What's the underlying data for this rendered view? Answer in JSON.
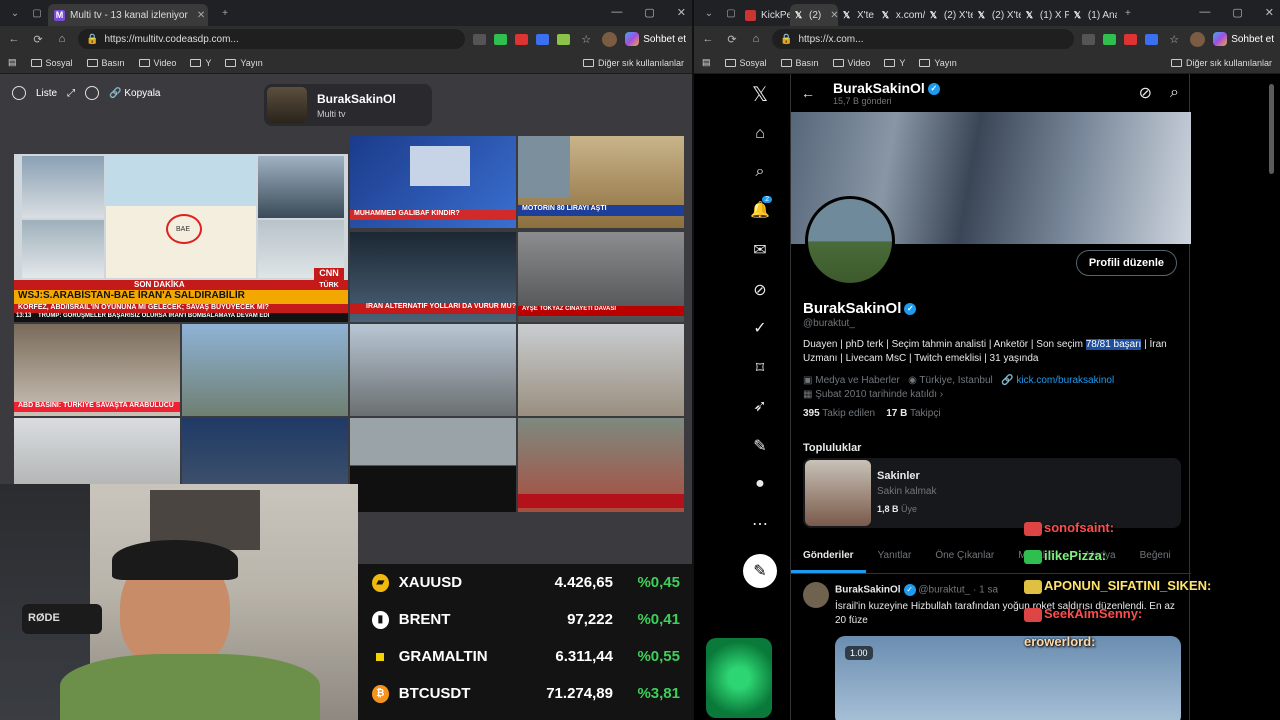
{
  "left_window": {
    "tab_title": "Multi tv - 13 kanal izleniyor",
    "url": "https://multitv.codeasdp.com...",
    "copilot_label": "Sohbet et",
    "bookmarks": [
      "Sosyal",
      "Basın",
      "Video",
      "Y",
      "Yayın"
    ],
    "bookmarks_right": "Diğer sık kullanılanlar"
  },
  "right_window": {
    "tabs": [
      "KickPe",
      "(2)",
      "X'te",
      "x.com/",
      "(2) X'te",
      "(2) X'te",
      "(1) X P",
      "(1) Ana"
    ],
    "url": "https://x.com...",
    "copilot_label": "Sohbet et",
    "bookmarks": [
      "Sosyal",
      "Basın",
      "Video",
      "Y",
      "Yayın"
    ],
    "bookmarks_right": "Diğer sık kullanılanlar"
  },
  "multitv": {
    "toolbar": {
      "list_label": "Liste",
      "copy_label": "Kopyala"
    },
    "channel": {
      "name": "BurakSakinOl",
      "subtitle": "Multi tv"
    },
    "tiles": {
      "cnn_son_dakika": "SON DAKİKA",
      "cnn_headline": "WSJ:S.ARABİSTAN-BAE İRAN'A SALDIRABİLİR",
      "cnn_sub": "KÖRFEZ, ABD/İSRAİL'İN OYUNUNA MI GELECEK; SAVAŞ BÜYÜYECEK Mİ?",
      "cnn_ticker": "TRUMP: GÖRÜŞMELER BAŞARISIZ OLURSA İRAN'I BOMBALAMAYA DEVAM EDİ",
      "cnn_time": "13:13",
      "cnn_logo": "CNN",
      "cnn_logo_sub": "TÜRK",
      "cnn_canli": "CANLI",
      "map_label": "BAE",
      "name_strip": "MUHAMMED GALİBAF KİNDİR?",
      "motorin": "MOTORİN 80 LİRAYI AŞTI",
      "iran_alt": "İRAN ALTERNATİF YOLLARI DA VURUR MU?",
      "abd_basini": "ABD BASINI: TÜRKİYE SAVAŞTA ARABULUCU",
      "ayse": "AYŞE TOKYAZ CİNAYETİ DAVASI"
    },
    "ticker": [
      {
        "symbol": "XAUUSD",
        "price": "4.426,65",
        "change": "%0,45",
        "color": "#f0b90b",
        "icon": "gold-bars-icon"
      },
      {
        "symbol": "BRENT",
        "price": "97,222",
        "change": "%0,41",
        "color": "#ffffff",
        "icon": "oil-barrel-icon"
      },
      {
        "symbol": "GRAMALTIN",
        "price": "6.311,44",
        "change": "%0,55",
        "color": "#f5d300",
        "icon": "gold-square-icon"
      },
      {
        "symbol": "BTCUSDT",
        "price": "71.274,89",
        "change": "%3,81",
        "color": "#f7931a",
        "icon": "bitcoin-icon"
      }
    ],
    "webcam_mic_brand": "RØDE"
  },
  "x_profile": {
    "header_name": "BurakSakinOl",
    "header_count": "15,7 B gönderi",
    "edit_button": "Profili düzenle",
    "display_name": "BurakSakinOl",
    "handle": "@buraktut_",
    "bio_pre": "Duayen | phD terk | Seçim tahmin analisti | Anketör | Son seçim ",
    "bio_highlight": "78/81 başarı",
    "bio_post": " | İran Uzmanı | Livecam MsC | Twitch emeklisi | 31 yaşında",
    "category": "Medya ve Haberler",
    "location": "Türkiye, Istanbul",
    "link": "kick.com/buraksakinol",
    "joined": "Şubat 2010 tarihinde katıldı",
    "following_count": "395",
    "following_label": "Takip edilen",
    "followers_count": "17 B",
    "followers_label": "Takipçi",
    "communities_title": "Topluluklar",
    "community": {
      "name": "Sakinler",
      "subtitle": "Sakin kalmak",
      "members": "1,8 B",
      "members_label": "Üye"
    },
    "tabs": [
      "Gönderiler",
      "Yanıtlar",
      "Öne Çıkanlar",
      "Makaleler",
      "Medya",
      "Beğeni"
    ],
    "post": {
      "name": "BurakSakinOl",
      "handle": "@buraktut_",
      "time": "· 1 sa",
      "text": "İsrail'in kuzeyine Hizbullah tarafından yoğun roket saldırısı düzenlendi. En az 20 füze",
      "media_badge": "1.00"
    },
    "notification_count": "2"
  },
  "chat_overlay": [
    {
      "user": "sonofsaint:",
      "color": "#ff4d4d"
    },
    {
      "user": "ilikePizza:",
      "color": "#7ef07e"
    },
    {
      "user": "APONUN_SIFATINI_SIKEN:",
      "color": "#ffe36b"
    },
    {
      "user": "SeekAimSenny:",
      "color": "#ff4d4d"
    },
    {
      "user": "erowerlord:",
      "color": "#ffd9a8"
    }
  ]
}
